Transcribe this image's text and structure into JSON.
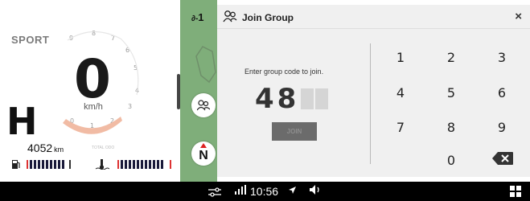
{
  "cluster": {
    "mode": "SPORT",
    "rpm_ticks": [
      "9",
      "8",
      "7",
      "6",
      "5",
      "4",
      "3",
      "2",
      "1",
      "0"
    ],
    "speed": "0",
    "speed_unit": "km/h",
    "gear": "H",
    "odometer": "4052",
    "odometer_unit": "km",
    "odometer_label": "TOTAL ODO",
    "fuel_icon": "fuel-pump-icon",
    "temp_icon": "coolant-temp-icon"
  },
  "map": {
    "signal_text": "1",
    "people_icon": "people-icon",
    "compass_label": "N"
  },
  "dialog": {
    "title": "Join Group",
    "close_label": "×",
    "prompt": "Enter group code to join.",
    "code_digits": [
      "4",
      "8"
    ],
    "join_label": "JOIN",
    "keypad": [
      "1",
      "2",
      "3",
      "4",
      "5",
      "6",
      "7",
      "8",
      "9",
      "0"
    ],
    "backspace_icon": "backspace-icon"
  },
  "statusbar": {
    "time": "10:56",
    "filter_icon": "sliders-icon",
    "signal_icon": "signal-bars-icon",
    "location_icon": "location-arrow-icon",
    "volume_icon": "volume-icon",
    "apps_icon": "grid-icon"
  }
}
